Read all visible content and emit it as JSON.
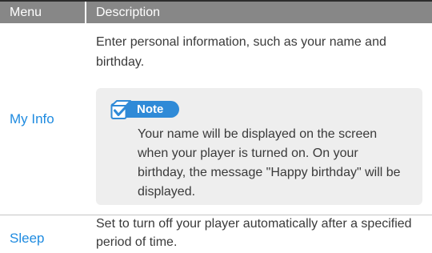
{
  "table": {
    "header": {
      "menu": "Menu",
      "description": "Description"
    },
    "rows": [
      {
        "menu": "My Info",
        "description": "Enter personal information, such as your name and birthday.",
        "note": {
          "label": "Note",
          "text": "Your name will be displayed on the screen when your player is turned on. On your birthday, the message \"Happy birthday\" will be displayed."
        }
      },
      {
        "menu": "Sleep",
        "description": "Set to turn off your player automatically after a specified period of time."
      }
    ]
  },
  "colors": {
    "header_bg": "#878787",
    "menu_link": "#1f8be0",
    "note_badge": "#2f8ad7",
    "note_bg": "#eeeeee"
  },
  "icons": {
    "note": "note-checkbox-icon"
  }
}
